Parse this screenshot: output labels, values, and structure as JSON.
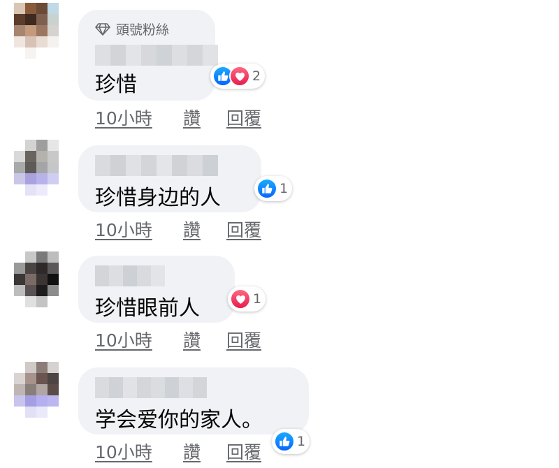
{
  "comments": [
    {
      "badge": "頭號粉絲",
      "text": "珍惜",
      "reaction_count": "2",
      "reactions": [
        "like-icon",
        "love-icon"
      ],
      "time": "10小時",
      "like_label": "讚",
      "reply_label": "回覆"
    },
    {
      "text": "珍惜身边的人",
      "reaction_count": "1",
      "reactions": [
        "like-icon"
      ],
      "time": "10小時",
      "like_label": "讚",
      "reply_label": "回覆"
    },
    {
      "text": "珍惜眼前人",
      "reaction_count": "1",
      "reactions": [
        "love-icon"
      ],
      "time": "10小時",
      "like_label": "讚",
      "reply_label": "回覆"
    },
    {
      "text": "学会爱你的家人。",
      "reaction_count": "1",
      "reactions": [
        "like-icon"
      ],
      "time": "10小時",
      "like_label": "讚",
      "reply_label": "回覆"
    }
  ],
  "colors": {
    "bubble": "#f0f2f5",
    "meta_text": "#65676b",
    "like_blue": "#0866ff",
    "love_red": "#e61e4d"
  }
}
